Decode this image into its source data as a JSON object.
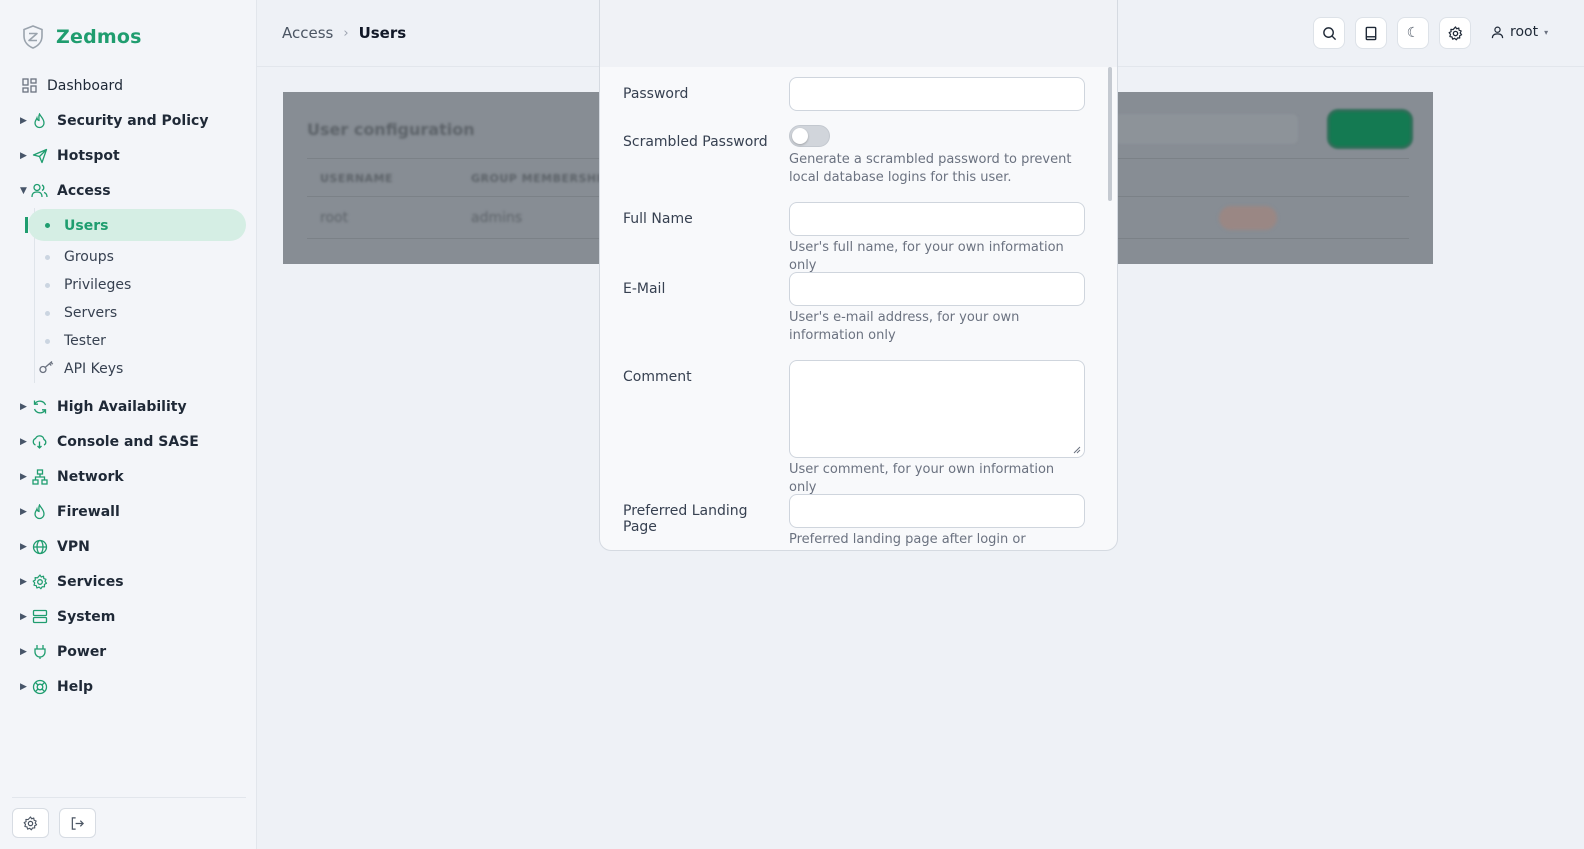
{
  "brand": {
    "name": "Zedmos"
  },
  "sidebar": {
    "dashboard": "Dashboard",
    "sections": [
      {
        "label": "Security and Policy",
        "icon": "flame-icon"
      },
      {
        "label": "Hotspot",
        "icon": "paper-plane-icon"
      },
      {
        "label": "Access",
        "icon": "users-icon"
      }
    ],
    "access_items": [
      "Users",
      "Groups",
      "Privileges",
      "Servers",
      "Tester",
      "API Keys"
    ],
    "more_sections": [
      {
        "label": "High Availability",
        "icon": "refresh-icon"
      },
      {
        "label": "Console and SASE",
        "icon": "cloud-icon"
      },
      {
        "label": "Network",
        "icon": "network-icon"
      },
      {
        "label": "Firewall",
        "icon": "flame-icon"
      },
      {
        "label": "VPN",
        "icon": "globe-icon"
      },
      {
        "label": "Services",
        "icon": "gear-icon"
      },
      {
        "label": "System",
        "icon": "server-icon"
      },
      {
        "label": "Power",
        "icon": "plug-icon"
      },
      {
        "label": "Help",
        "icon": "lifebuoy-icon"
      }
    ]
  },
  "header": {
    "breadcrumb_parent": "Access",
    "breadcrumb_sep": "›",
    "breadcrumb_current": "Users",
    "user": "root",
    "user_caret": "▾"
  },
  "background": {
    "title": "User configuration",
    "columns": [
      "USERNAME",
      "GROUP MEMBERSHIP"
    ],
    "row": {
      "username": "root",
      "group": "admins"
    }
  },
  "form": {
    "password_label": "Password",
    "scrambled_label": "Scrambled Password",
    "scrambled_help": "Generate a scrambled password to prevent local database logins for this user.",
    "scrambled_enabled": false,
    "fullname_label": "Full Name",
    "fullname_help": "User's full name, for your own information only",
    "email_label": "E-Mail",
    "email_help": "User's e-mail address, for your own information only",
    "comment_label": "Comment",
    "comment_help": "User comment, for your own information only",
    "landing_label": "Preferred Landing Page",
    "landing_help": "Preferred landing page after login or"
  },
  "colors": {
    "accent": "#1f9d6f",
    "accent_soft": "#d5eee4"
  }
}
